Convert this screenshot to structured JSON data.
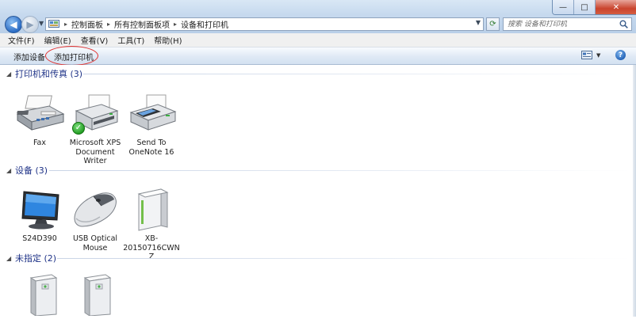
{
  "window": {
    "minimize_symbol": "—",
    "maximize_symbol": "□",
    "close_symbol": "✕"
  },
  "address_bar": {
    "breadcrumbs": [
      "控制面板",
      "所有控制面板项",
      "设备和打印机"
    ],
    "search_placeholder": "搜索 设备和打印机"
  },
  "menu": {
    "items": [
      "文件(F)",
      "编辑(E)",
      "查看(V)",
      "工具(T)",
      "帮助(H)"
    ]
  },
  "toolbar": {
    "add_device": "添加设备",
    "add_printer": "添加打印机",
    "help_symbol": "?"
  },
  "groups": [
    {
      "title": "打印机和传真 (3)",
      "items": [
        {
          "label": "Fax",
          "icon": "fax-icon"
        },
        {
          "label": "Microsoft XPS Document Writer",
          "icon": "printer-icon",
          "default": true
        },
        {
          "label": "Send To OneNote 16",
          "icon": "printer-icon"
        }
      ]
    },
    {
      "title": "设备 (3)",
      "items": [
        {
          "label": "S24D390",
          "icon": "monitor-icon"
        },
        {
          "label": "USB Optical Mouse",
          "icon": "mouse-icon"
        },
        {
          "label": "XB-20150716CWNZ",
          "icon": "computer-tower-icon"
        }
      ]
    },
    {
      "title": "未指定 (2)",
      "items": [
        {
          "label": "",
          "icon": "unspecified-device-icon"
        },
        {
          "label": "",
          "icon": "unspecified-device-icon"
        }
      ]
    }
  ],
  "colors": {
    "group_title": "#1e3287",
    "highlight_circle": "#e0312f",
    "default_check": "#1f9a1f"
  }
}
